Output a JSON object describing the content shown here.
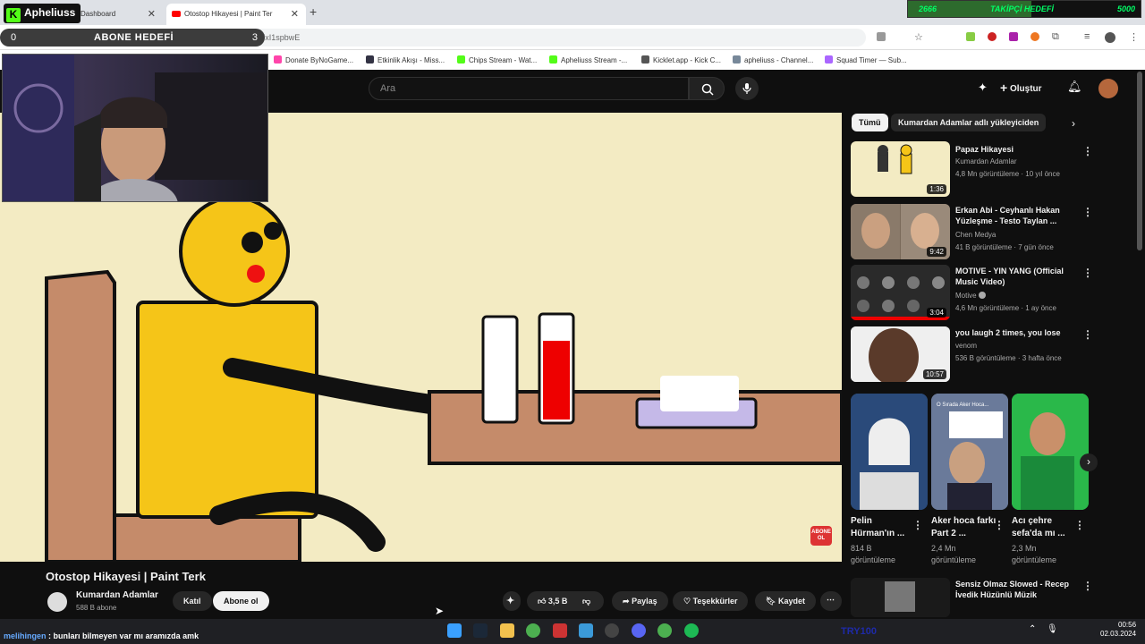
{
  "browser": {
    "tabs": [
      {
        "label": "Dashboard",
        "active": false
      },
      {
        "label": "Otostop Hikayesi | Paint Ter",
        "active": true
      }
    ],
    "url": "=Yv7xI1spbwE"
  },
  "overlays": {
    "brand": "Apheliuss",
    "brand_icon": "kick-logo-icon",
    "abone_goal": {
      "label": "ABONE HEDEFİ",
      "current": "0",
      "target": "3"
    },
    "takipci_goal": {
      "label": "TAKİPÇİ HEDEFİ",
      "current": "2666",
      "target": "5000",
      "progress": 0.53
    },
    "chat": {
      "user": "melihingen",
      "message": ": bunları bilmeyen var mı aramızda amk"
    }
  },
  "bookmarks": [
    {
      "label": "Donate ByNoGame...",
      "color": "#f4a",
      "icon": "bynogame-icon"
    },
    {
      "label": "Etkinlik Akışı - Miss...",
      "color": "#334",
      "icon": "streamlabs-icon"
    },
    {
      "label": "Chips Stream - Wat...",
      "color": "#53fc18",
      "icon": "kick-icon"
    },
    {
      "label": "Apheliuss Stream -...",
      "color": "#53fc18",
      "icon": "kick-icon"
    },
    {
      "label": "Kicklet.app - Kick C...",
      "color": "#555",
      "icon": "kicklet-icon"
    },
    {
      "label": "apheliuss - Channel...",
      "color": "#789",
      "icon": "channel-icon"
    },
    {
      "label": "Squad Timer — Sub...",
      "color": "#a6f",
      "icon": "timer-icon"
    }
  ],
  "youtube": {
    "search_placeholder": "Ara",
    "create_label": "Oluştur",
    "video": {
      "title": "Otostop Hikayesi | Paint Terk",
      "channel": "Kumardan Adamlar",
      "subs": "588 B abone",
      "join_label": "Katıl",
      "subscribe_label": "Abone ol",
      "likes": "3,5 B",
      "share_label": "Paylaş",
      "thanks_label": "Teşekkürler",
      "save_label": "Kaydet",
      "watermark": "ABONE OL"
    },
    "chips": [
      "Tümü",
      "Kumardan Adamlar adlı yükleyiciden"
    ],
    "recommendations": [
      {
        "title": "Papaz Hikayesi",
        "channel": "Kumardan Adamlar",
        "meta": "4,8 Mn görüntüleme · 10 yıl önce",
        "duration": "1:36",
        "bg": "#f3ebc3"
      },
      {
        "title": "Erkan Abi - Ceyhanlı Hakan Yüzleşme - Testo Taylan ...",
        "channel": "Chen Medya",
        "meta": "41 B görüntüleme · 7 gün önce",
        "duration": "9:42",
        "bg": "#7a6a5a"
      },
      {
        "title": "MOTIVE - YIN YANG (Official Music Video)",
        "channel": "Motive",
        "meta": "4,6 Mn görüntüleme · 1 ay önce",
        "duration": "3:04",
        "bg": "#3a3a3a"
      },
      {
        "title": "you laugh 2 times, you lose",
        "channel": "venom",
        "meta": "536 B görüntüleme · 3 hafta önce",
        "duration": "10:57",
        "bg": "#e8e8e8"
      }
    ],
    "shorts": [
      {
        "title": "Pelin Hürman'ın ...",
        "views": "814 B görüntüleme",
        "bg": "#2a4a7a"
      },
      {
        "title": "Aker hoca farkı Part 2 ...",
        "views": "2,4 Mn görüntüleme",
        "bg": "#5a6a8a",
        "caption": "O Sırada Aker Hoca..."
      },
      {
        "title": "Acı çehre sefa'da mı ...",
        "views": "2,3 Mn görüntüleme",
        "bg": "#2aaa4a"
      }
    ],
    "last_rec": {
      "title": "Sensiz Olmaz Slowed - Recep İvedik Hüzünlü Müzik"
    }
  },
  "taskbar": {
    "clock_time": "00:56",
    "clock_date": "02.03.2024",
    "tray_text": "TRY100"
  }
}
